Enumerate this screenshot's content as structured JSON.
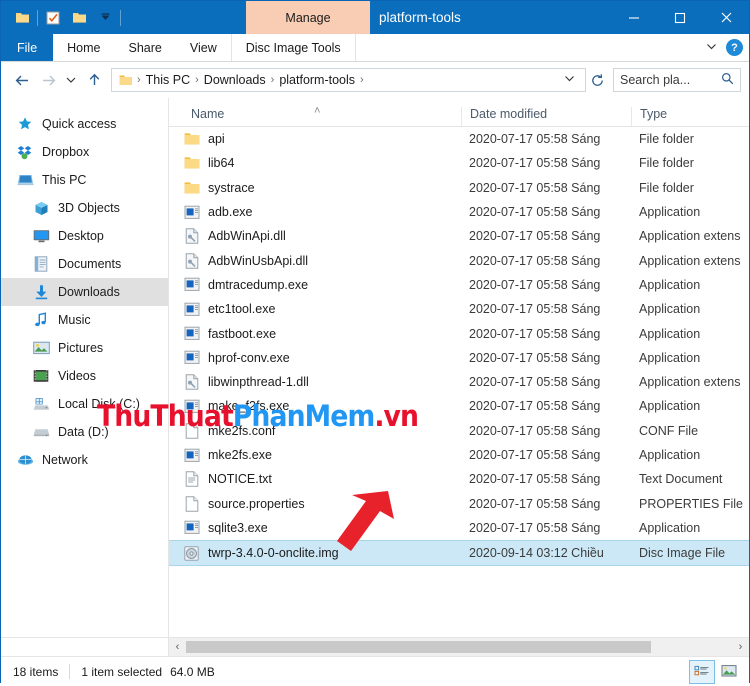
{
  "window": {
    "title": "platform-tools",
    "contextual_tab": "Manage",
    "minimize_icon": "minimize-icon",
    "maximize_icon": "maximize-icon",
    "close_icon": "close-icon",
    "quick_access": [
      {
        "name": "folder-icon"
      },
      {
        "name": "properties-checkbox-icon"
      },
      {
        "name": "new-folder-icon"
      },
      {
        "name": "customize-chevron-down-icon"
      }
    ]
  },
  "ribbon": {
    "tabs": [
      {
        "label": "File",
        "active": false
      },
      {
        "label": "Home",
        "active": false
      },
      {
        "label": "Share",
        "active": false
      },
      {
        "label": "View",
        "active": false
      },
      {
        "label": "Disc Image Tools",
        "active": true
      }
    ],
    "collapse_icon": "chevron-down-icon",
    "help_label": "?"
  },
  "addressbar": {
    "back_icon": "arrow-left-icon",
    "forward_icon": "arrow-right-icon",
    "recent_icon": "chevron-down-icon",
    "up_icon": "arrow-up-icon",
    "folder_icon": "folder-icon",
    "crumbs": [
      "This PC",
      "Downloads",
      "platform-tools"
    ],
    "separator": "›",
    "dropdown_icon": "chevron-down-icon",
    "refresh_icon": "refresh-icon",
    "search": {
      "placeholder": "Search pla...",
      "icon": "search-icon"
    }
  },
  "sidebar": {
    "items": [
      {
        "label": "Quick access",
        "icon": "star-icon",
        "indent": false,
        "selected": false
      },
      {
        "label": "Dropbox",
        "icon": "dropbox-icon",
        "indent": false,
        "selected": false
      },
      {
        "label": "This PC",
        "icon": "computer-icon",
        "indent": false,
        "selected": false
      },
      {
        "label": "3D Objects",
        "icon": "3d-objects-icon",
        "indent": true,
        "selected": false
      },
      {
        "label": "Desktop",
        "icon": "desktop-icon",
        "indent": true,
        "selected": false
      },
      {
        "label": "Documents",
        "icon": "documents-icon",
        "indent": true,
        "selected": false
      },
      {
        "label": "Downloads",
        "icon": "downloads-icon",
        "indent": true,
        "selected": true
      },
      {
        "label": "Music",
        "icon": "music-icon",
        "indent": true,
        "selected": false
      },
      {
        "label": "Pictures",
        "icon": "pictures-icon",
        "indent": true,
        "selected": false
      },
      {
        "label": "Videos",
        "icon": "videos-icon",
        "indent": true,
        "selected": false
      },
      {
        "label": "Local Disk (C:)",
        "icon": "local-disk-icon",
        "indent": true,
        "selected": false
      },
      {
        "label": "Data (D:)",
        "icon": "drive-icon",
        "indent": true,
        "selected": false
      },
      {
        "label": "Network",
        "icon": "network-icon",
        "indent": false,
        "selected": false
      }
    ]
  },
  "filelist": {
    "columns": [
      {
        "label": "Name",
        "sort": "asc"
      },
      {
        "label": "Date modified",
        "sort": null
      },
      {
        "label": "Type",
        "sort": null
      }
    ],
    "sort_caret": "˄",
    "rows": [
      {
        "name": "api",
        "date": "2020-07-17 05:58 Sáng",
        "type": "File folder",
        "icon": "folder-icon",
        "selected": false
      },
      {
        "name": "lib64",
        "date": "2020-07-17 05:58 Sáng",
        "type": "File folder",
        "icon": "folder-icon",
        "selected": false
      },
      {
        "name": "systrace",
        "date": "2020-07-17 05:58 Sáng",
        "type": "File folder",
        "icon": "folder-icon",
        "selected": false
      },
      {
        "name": "adb.exe",
        "date": "2020-07-17 05:58 Sáng",
        "type": "Application",
        "icon": "application-icon",
        "selected": false
      },
      {
        "name": "AdbWinApi.dll",
        "date": "2020-07-17 05:58 Sáng",
        "type": "Application extens",
        "icon": "dll-icon",
        "selected": false
      },
      {
        "name": "AdbWinUsbApi.dll",
        "date": "2020-07-17 05:58 Sáng",
        "type": "Application extens",
        "icon": "dll-icon",
        "selected": false
      },
      {
        "name": "dmtracedump.exe",
        "date": "2020-07-17 05:58 Sáng",
        "type": "Application",
        "icon": "application-icon",
        "selected": false
      },
      {
        "name": "etc1tool.exe",
        "date": "2020-07-17 05:58 Sáng",
        "type": "Application",
        "icon": "application-icon",
        "selected": false
      },
      {
        "name": "fastboot.exe",
        "date": "2020-07-17 05:58 Sáng",
        "type": "Application",
        "icon": "application-icon",
        "selected": false
      },
      {
        "name": "hprof-conv.exe",
        "date": "2020-07-17 05:58 Sáng",
        "type": "Application",
        "icon": "application-icon",
        "selected": false
      },
      {
        "name": "libwinpthread-1.dll",
        "date": "2020-07-17 05:58 Sáng",
        "type": "Application extens",
        "icon": "dll-icon",
        "selected": false
      },
      {
        "name": "make_f2fs.exe",
        "date": "2020-07-17 05:58 Sáng",
        "type": "Application",
        "icon": "application-icon",
        "selected": false
      },
      {
        "name": "mke2fs.conf",
        "date": "2020-07-17 05:58 Sáng",
        "type": "CONF File",
        "icon": "blank-file-icon",
        "selected": false
      },
      {
        "name": "mke2fs.exe",
        "date": "2020-07-17 05:58 Sáng",
        "type": "Application",
        "icon": "application-icon",
        "selected": false
      },
      {
        "name": "NOTICE.txt",
        "date": "2020-07-17 05:58 Sáng",
        "type": "Text Document",
        "icon": "text-document-icon",
        "selected": false
      },
      {
        "name": "source.properties",
        "date": "2020-07-17 05:58 Sáng",
        "type": "PROPERTIES File",
        "icon": "blank-file-icon",
        "selected": false
      },
      {
        "name": "sqlite3.exe",
        "date": "2020-07-17 05:58 Sáng",
        "type": "Application",
        "icon": "application-icon",
        "selected": false
      },
      {
        "name": "twrp-3.4.0-0-onclite.img",
        "date": "2020-09-14 03:12 Chiều",
        "type": "Disc Image File",
        "icon": "disc-image-icon",
        "selected": true
      }
    ]
  },
  "scrollbar": {
    "left_arrow": "‹",
    "right_arrow": "›"
  },
  "statusbar": {
    "item_count": "18 items",
    "selection": "1 item selected",
    "size": "64.0 MB",
    "details_view_icon": "details-view-icon",
    "large_icons_view_icon": "large-icons-view-icon"
  },
  "overlay": {
    "watermark": {
      "part1": "ThuThuat",
      "part2": "PhanMem",
      "part3": ".vn",
      "color1": "#e8112d",
      "color2": "#2196f3"
    },
    "arrow": {
      "name": "pointer-arrow",
      "color": "#e8222a"
    }
  },
  "colors": {
    "titlebar": "#0a6ebd",
    "contextual_tab": "#f9cdb4",
    "selection": "#cce8f6",
    "sidebar_selection": "#e0e0e0"
  }
}
